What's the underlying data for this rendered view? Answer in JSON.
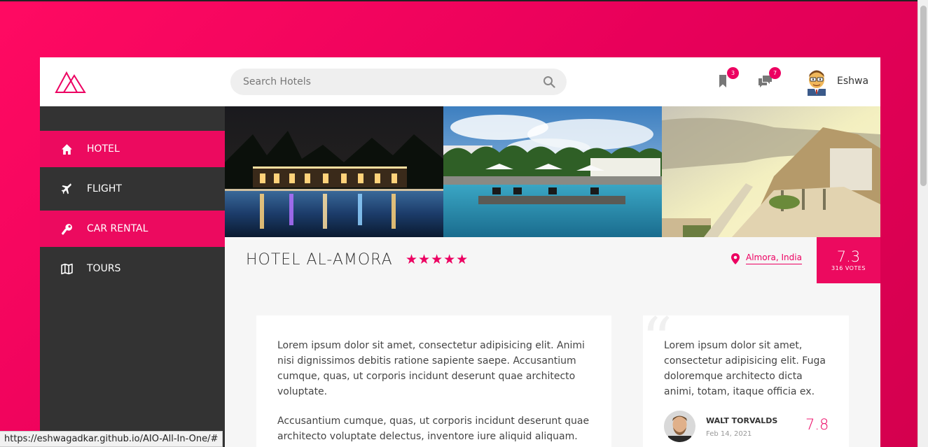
{
  "header": {
    "search_placeholder": "Search Hotels",
    "bookmark_count": "3",
    "message_count": "7",
    "username": "Eshwa"
  },
  "sidebar": {
    "items": [
      {
        "label": "HOTEL",
        "icon": "home-icon",
        "active": true
      },
      {
        "label": "FLIGHT",
        "icon": "plane-icon",
        "active": false
      },
      {
        "label": "CAR RENTAL",
        "icon": "wrench-icon",
        "active": true
      },
      {
        "label": "TOURS",
        "icon": "map-icon",
        "active": false
      }
    ]
  },
  "hotel": {
    "name": "HOTEL AL-AMORA",
    "stars": "★★★★★",
    "location": "Almora, India",
    "score": "7.3",
    "votes": "316 VOTES"
  },
  "description": {
    "paragraph1": "Lorem ipsum dolor sit amet, consectetur adipisicing elit. Animi nisi dignissimos debitis ratione sapiente saepe. Accusantium cumque, quas, ut corporis incidunt deserunt quae architecto voluptate.",
    "paragraph2": "Accusantium cumque, quas, ut corporis incidunt deserunt quae architecto voluptate delectus, inventore iure aliquid aliquam."
  },
  "review": {
    "text": "Lorem ipsum dolor sit amet, consectetur adipisicing elit. Fuga doloremque architecto dicta animi, totam, itaque officia ex.",
    "reviewer_name": "WALT TORVALDS",
    "date": "Feb 14, 2021",
    "score": "7.8"
  },
  "status_url": "https://eshwagadkar.github.io/AIO-All-In-One/#",
  "colors": {
    "accent": "#ec0061",
    "sidebar_bg": "#333333",
    "background_gradient_start": "#ff0a62"
  }
}
